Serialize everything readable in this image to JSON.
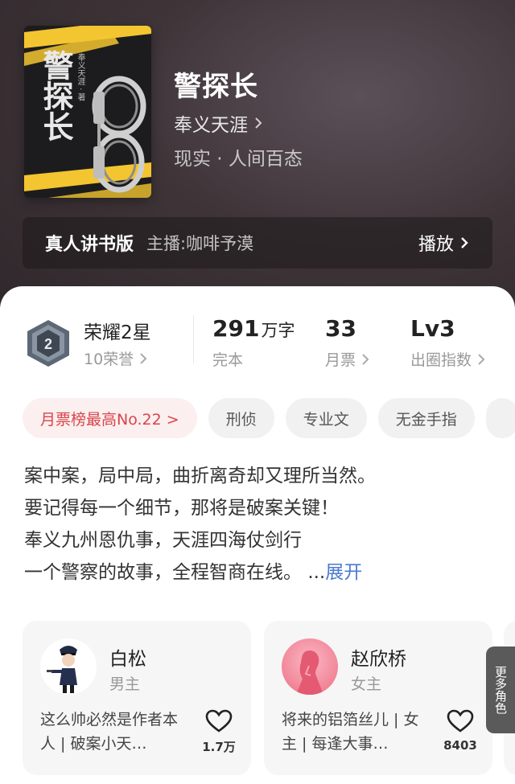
{
  "book": {
    "title": "警探长",
    "author": "奉义天涯",
    "genre": "现实 · 人间百态",
    "cover_text": "警探长",
    "cover_author": "奉义天涯 · 著"
  },
  "audio": {
    "title": "真人讲书版",
    "host": "主播:咖啡予漠",
    "play_label": "播放"
  },
  "stats": {
    "honor_title": "荣耀2星",
    "honor_sub": "10荣誉",
    "honor_level": "2",
    "words_value": "291",
    "words_unit": "万字",
    "words_status": "完本",
    "monthly_value": "33",
    "monthly_label": "月票",
    "index_value": "Lv3",
    "index_label": "出圈指数"
  },
  "tags": [
    "月票榜最高No.22 >",
    "刑侦",
    "专业文",
    "无金手指"
  ],
  "description": [
    "案中案，局中局，曲折离奇却又理所当然。",
    "要记得每一个细节，那将是破案关键！",
    "奉义九州恩仇事，天涯四海仗剑行",
    "一个警察的故事，全程智商在线。"
  ],
  "description_more": {
    "ellipsis": "...",
    "link": "展开"
  },
  "characters": [
    {
      "name": "白松",
      "role": "男主",
      "desc": "这么帅必然是作者本人 | 破案小天…",
      "likes": "1.7万"
    },
    {
      "name": "赵欣桥",
      "role": "女主",
      "desc": "将来的铝箔丝儿 | 女主 | 每逢大事…",
      "likes": "8403"
    }
  ],
  "more_roles_label": "更多角色",
  "colors": {
    "accent_red": "#d9454b",
    "link_blue": "#4a7bd1",
    "hero_bg": "#3f3539"
  }
}
